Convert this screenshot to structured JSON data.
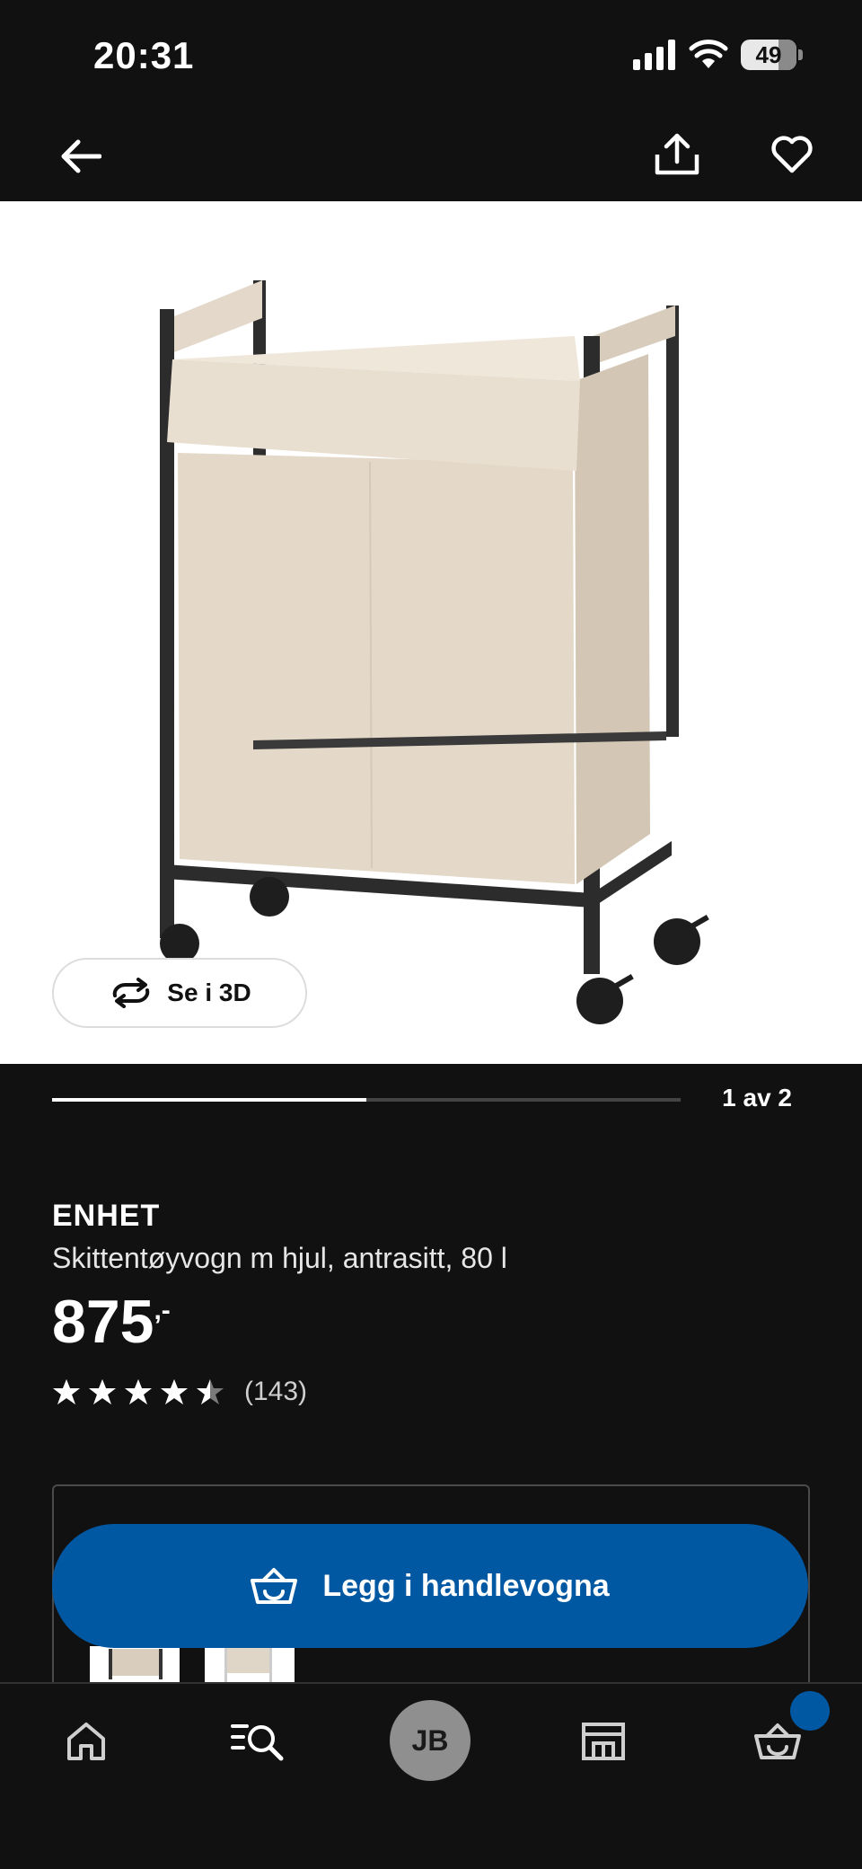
{
  "status": {
    "time": "20:31",
    "battery": "49"
  },
  "product": {
    "brand": "ENHET",
    "description": "Skittentøyvogn m hjul, antrasitt, 80 l",
    "price": "875",
    "price_suffix": ",-",
    "rating": 4.5,
    "review_count": "(143)"
  },
  "gallery": {
    "view_3d_label": "Se i 3D",
    "counter": "1 av 2",
    "progress": 0.5
  },
  "actions": {
    "add_to_cart_label": "Legg i handlevogna"
  },
  "bottom_nav": {
    "avatar_initials": "JB"
  },
  "colors": {
    "accent": "#0058a3",
    "background": "#111111"
  }
}
